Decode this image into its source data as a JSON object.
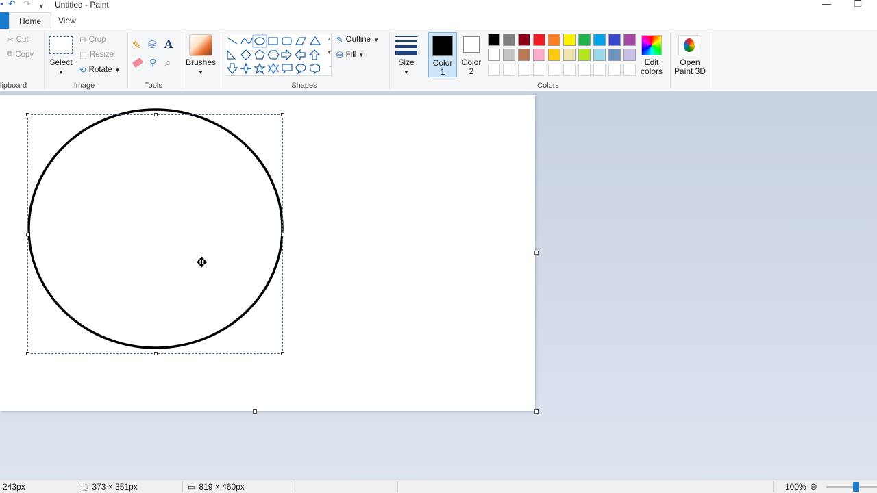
{
  "window": {
    "title": "Untitled - Paint",
    "minimize_glyph": "—",
    "restore_glyph": "❐"
  },
  "tabs": [
    {
      "label": "Home"
    },
    {
      "label": "View"
    }
  ],
  "ribbon": {
    "clipboard": {
      "group_label": "lipboard",
      "cut": "Cut",
      "copy": "Copy"
    },
    "image": {
      "group_label": "Image",
      "select": "Select",
      "crop": "Crop",
      "resize": "Resize",
      "rotate": "Rotate"
    },
    "tools": {
      "group_label": "Tools"
    },
    "brushes": {
      "label": "Brushes"
    },
    "shapes": {
      "group_label": "Shapes",
      "outline": "Outline",
      "fill": "Fill"
    },
    "size": {
      "label": "Size"
    },
    "colors": {
      "group_label": "Colors",
      "color1_l1": "Color",
      "color1_l2": "1",
      "color2_l1": "Color",
      "color2_l2": "2",
      "color1_value": "#000000",
      "color2_value": "#ffffff",
      "edit_l1": "Edit",
      "edit_l2": "colors",
      "palette_row1": [
        "#000000",
        "#7f7f7f",
        "#880015",
        "#ed1c24",
        "#ff7f27",
        "#fff200",
        "#22b14c",
        "#00a2e8",
        "#3f48cc",
        "#a349a4"
      ],
      "palette_row2": [
        "#ffffff",
        "#c3c3c3",
        "#b97a57",
        "#ffaec9",
        "#ffc90e",
        "#efe4b0",
        "#b5e61d",
        "#99d9ea",
        "#7092be",
        "#c8bfe7"
      ]
    },
    "paint3d": {
      "l1": "Open",
      "l2": "Paint 3D"
    }
  },
  "status": {
    "cursor_pos": "243px",
    "selection_size": "373 × 351px",
    "canvas_size": "819 × 460px",
    "zoom": "100%",
    "zoom_level": 0.5
  }
}
